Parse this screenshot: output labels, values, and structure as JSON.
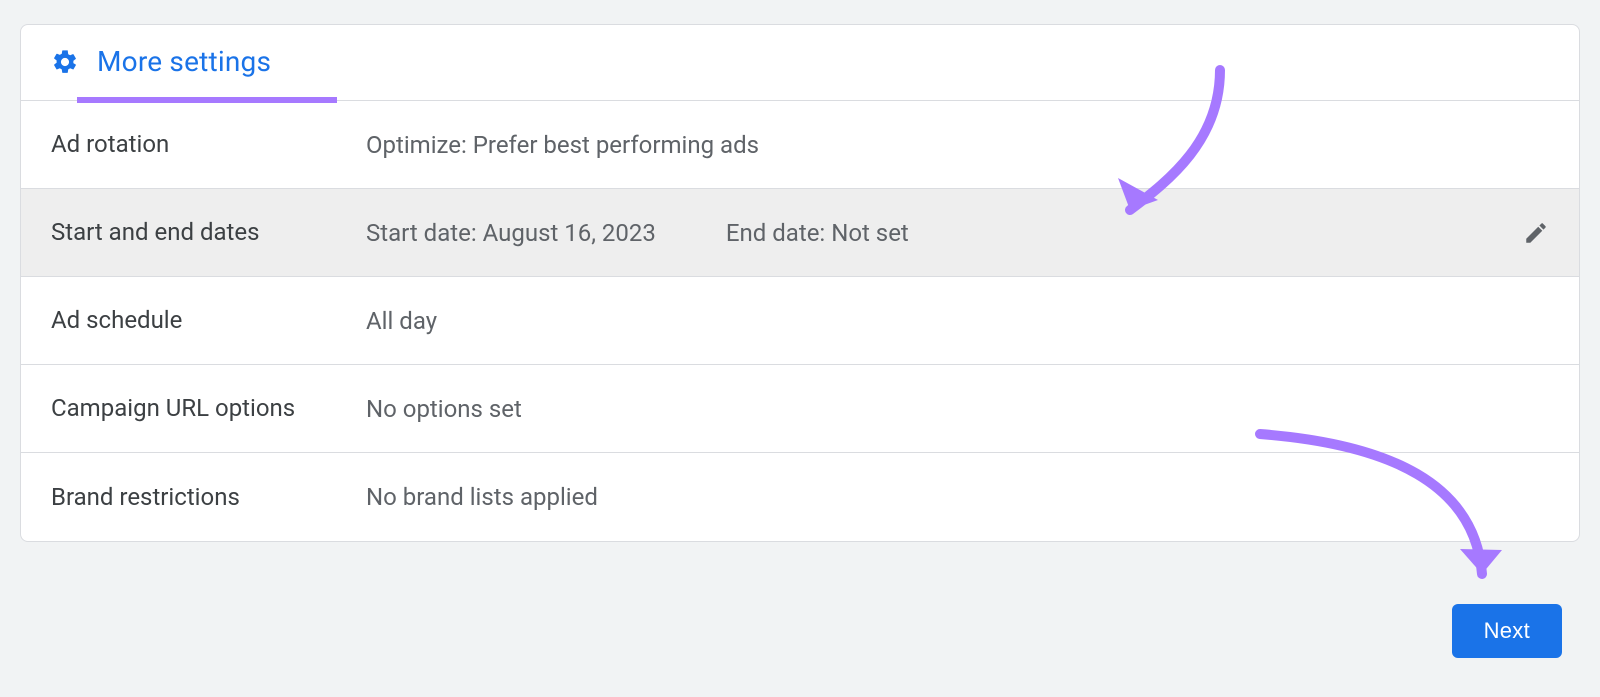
{
  "header": {
    "title": "More settings",
    "icon": "gear-icon"
  },
  "rows": {
    "ad_rotation": {
      "label": "Ad rotation",
      "value": "Optimize: Prefer best performing ads"
    },
    "dates": {
      "label": "Start and end dates",
      "start": "Start date: August 16, 2023",
      "end": "End date: Not set"
    },
    "ad_schedule": {
      "label": "Ad schedule",
      "value": "All day"
    },
    "campaign_url": {
      "label": "Campaign URL options",
      "value": "No options set"
    },
    "brand_restrictions": {
      "label": "Brand restrictions",
      "value": "No brand lists applied"
    }
  },
  "next_button": "Next",
  "colors": {
    "accent": "#1a73e8",
    "annotation": "#a679ff"
  }
}
